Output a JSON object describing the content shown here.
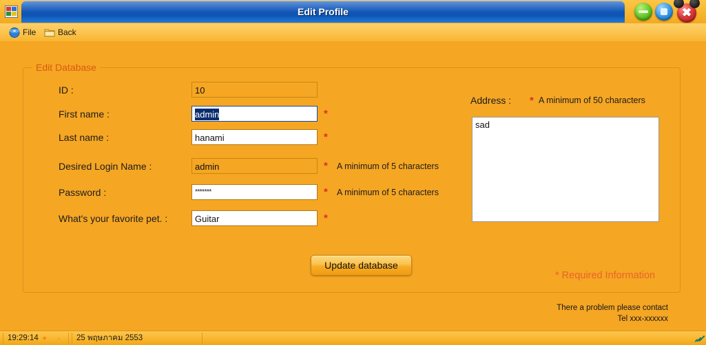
{
  "window": {
    "title": "Edit Profile",
    "app_icon": "form-window-icon",
    "minimize_label": "",
    "maximize_label": "",
    "close_label": "✖"
  },
  "menubar": {
    "items": [
      {
        "label": "File",
        "icon": "disk-icon"
      },
      {
        "label": "Back",
        "icon": "folder-icon"
      }
    ]
  },
  "groupbox": {
    "legend": "Edit Database"
  },
  "form": {
    "fields": [
      {
        "label": "ID :",
        "value": "10",
        "readonly": true,
        "required": false,
        "hint": ""
      },
      {
        "label": "First name :",
        "value": "admin",
        "readonly": false,
        "required": true,
        "hint": "",
        "selected": true
      },
      {
        "label": "Last name :",
        "value": "hanami",
        "readonly": false,
        "required": true,
        "hint": ""
      },
      {
        "label": "Desired Login Name :",
        "value": "admin",
        "readonly": true,
        "required": true,
        "hint": "A minimum of 5 characters"
      },
      {
        "label": "Password :",
        "value": "*******",
        "readonly": false,
        "required": true,
        "hint": "A minimum of 5 characters",
        "masked": true
      },
      {
        "label": "What's your favorite pet.  :",
        "value": "Guitar",
        "readonly": false,
        "required": true,
        "hint": ""
      }
    ]
  },
  "address": {
    "label": "Address  :",
    "star": "*",
    "hint": "A minimum of 50 characters",
    "value": "sad"
  },
  "actions": {
    "update_label": "Update database"
  },
  "notes": {
    "required_information": "* Required Information",
    "footer_line1": "There a problem please contact",
    "footer_line2": "Tel xxx-xxxxxx"
  },
  "statusbar": {
    "time": "19:29:14",
    "date": "25 พฤษภาคม 2553",
    "grip": "resize-grip-icon"
  },
  "colors": {
    "background": "#f5a623",
    "titlebar_blue": "#1458b8",
    "accent_orange": "#d95b12",
    "required_red": "#d93025",
    "required_note": "#e8642a",
    "selection_blue": "#0a2d6e"
  }
}
